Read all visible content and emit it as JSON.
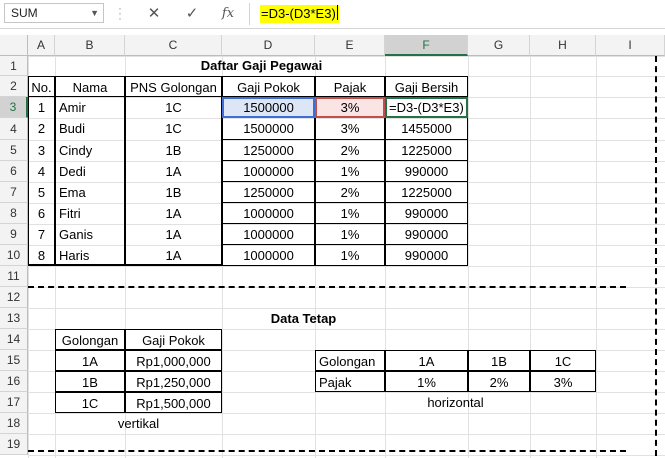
{
  "formula_bar": {
    "name_box": "SUM",
    "cancel_icon": "x-icon",
    "enter_icon": "check-icon",
    "function_icon": "fx-icon",
    "formula": "=D3-(D3*E3)"
  },
  "columns": [
    "A",
    "B",
    "C",
    "D",
    "E",
    "F",
    "G",
    "H",
    "I"
  ],
  "rows": [
    "1",
    "2",
    "3",
    "4",
    "5",
    "6",
    "7",
    "8",
    "9",
    "10",
    "11",
    "12",
    "13",
    "14",
    "15",
    "16",
    "17",
    "18",
    "19"
  ],
  "main_table": {
    "title": "Daftar Gaji Pegawai",
    "headers": [
      "No.",
      "Nama",
      "PNS Golongan",
      "Gaji Pokok",
      "Pajak",
      "Gaji Bersih"
    ],
    "rows": [
      [
        "1",
        "Amir",
        "1C",
        "1500000",
        "3%",
        "=D3-(D3*E3)"
      ],
      [
        "2",
        "Budi",
        "1C",
        "1500000",
        "3%",
        "1455000"
      ],
      [
        "3",
        "Cindy",
        "1B",
        "1250000",
        "2%",
        "1225000"
      ],
      [
        "4",
        "Dedi",
        "1A",
        "1000000",
        "1%",
        "990000"
      ],
      [
        "5",
        "Ema",
        "1B",
        "1250000",
        "2%",
        "1225000"
      ],
      [
        "6",
        "Fitri",
        "1A",
        "1000000",
        "1%",
        "990000"
      ],
      [
        "7",
        "Ganis",
        "1A",
        "1000000",
        "1%",
        "990000"
      ],
      [
        "8",
        "Haris",
        "1A",
        "1000000",
        "1%",
        "990000"
      ]
    ]
  },
  "data_tetap": {
    "title": "Data Tetap",
    "vertical": {
      "headers": [
        "Golongan",
        "Gaji Pokok"
      ],
      "rows": [
        [
          "1A",
          "Rp1,000,000"
        ],
        [
          "1B",
          "Rp1,250,000"
        ],
        [
          "1C",
          "Rp1,500,000"
        ]
      ],
      "caption": "vertikal"
    },
    "horizontal": {
      "rows": [
        [
          "Golongan",
          "1A",
          "1B",
          "1C"
        ],
        [
          "Pajak",
          "1%",
          "2%",
          "3%"
        ]
      ],
      "caption": "horizontal"
    }
  },
  "colors": {
    "accent": "#217346",
    "highlight_yellow": "#ffff00",
    "ref_blue": "#3d6fd6",
    "ref_red": "#c0504d",
    "active_green": "#217346"
  }
}
